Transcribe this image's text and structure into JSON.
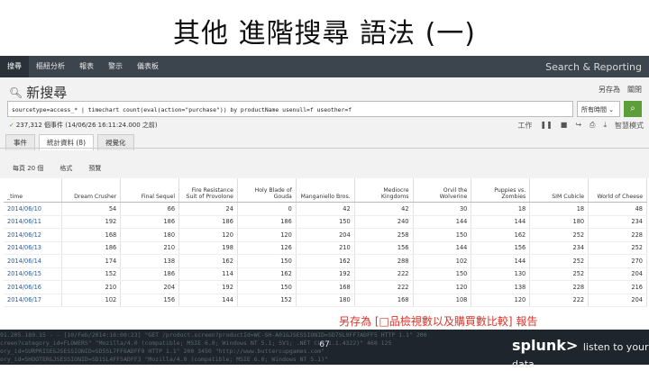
{
  "slide": {
    "title": "其他 進階搜尋 語法 (一)",
    "caption": "另存為 [□品檢視數以及購買數比較] 報告",
    "page_number": "67"
  },
  "nav": {
    "items": [
      "搜尋",
      "樞紐分析",
      "報表",
      "警示",
      "儀表板"
    ],
    "brand": "Search & Reporting"
  },
  "search": {
    "title": "新搜尋",
    "save_as": "另存為",
    "close": "關閉",
    "query": "sourcetype=access_* | timechart count(eval(action=\"purchase\")) by productName usenull=f useother=f",
    "time_range": "所有時間",
    "status": "237,312 個事件 (14/06/26 16:11:24.000 之前)",
    "job": "工作",
    "mode": "智慧模式"
  },
  "tabs": [
    "事件",
    "統計資料 (8)",
    "視覺化"
  ],
  "format_bar": [
    "每頁 20 個",
    "格式",
    "預覽"
  ],
  "table": {
    "columns": [
      "_time",
      "Dream Crusher",
      "Final Sequel",
      "Fire Resistance Suit of Provolone",
      "Holy Blade of Gouda",
      "Manganiello Bros.",
      "Mediocre Kingdoms",
      "Orvil the Wolverine",
      "Puppies vs. Zombies",
      "SIM Cubicle",
      "World of Cheese"
    ],
    "rows": [
      [
        "2014/06/10",
        "54",
        "66",
        "24",
        "0",
        "42",
        "42",
        "30",
        "18",
        "18",
        "48"
      ],
      [
        "2014/06/11",
        "192",
        "186",
        "186",
        "186",
        "150",
        "240",
        "144",
        "144",
        "180",
        "234"
      ],
      [
        "2014/06/12",
        "168",
        "180",
        "120",
        "120",
        "204",
        "258",
        "150",
        "162",
        "252",
        "228"
      ],
      [
        "2014/06/13",
        "186",
        "210",
        "198",
        "126",
        "210",
        "156",
        "144",
        "156",
        "234",
        "252"
      ],
      [
        "2014/06/14",
        "174",
        "138",
        "162",
        "150",
        "162",
        "288",
        "102",
        "144",
        "252",
        "270"
      ],
      [
        "2014/06/15",
        "152",
        "186",
        "114",
        "162",
        "192",
        "222",
        "150",
        "130",
        "252",
        "204"
      ],
      [
        "2014/06/16",
        "210",
        "204",
        "192",
        "150",
        "168",
        "222",
        "120",
        "138",
        "228",
        "216"
      ],
      [
        "2014/06/17",
        "102",
        "156",
        "144",
        "152",
        "180",
        "168",
        "108",
        "120",
        "222",
        "204"
      ]
    ]
  },
  "footer": {
    "logo": "splunk>",
    "tagline": "listen to your data",
    "log_lines": [
      "91.205.189.15 - - [10/Feb/2014:16:00:23] \"GET /product.screen?productId=WC-SH-A01&JSESSIONID=SD7SL9FF7ADFF5 HTTP 1.1\" 200",
      "creen?category_id=FLOWERS\" \"Mozilla/4.0 (compatible; MSIE 6.0; Windows NT 5.1; SV1; .NET CLR 1.1.4322)\" 468 125",
      "ory_id=SURPRISE&JSESSIONID=SD5SL7FF6ADFF9 HTTP 1.1\" 200 3450 \"http://www.buttercupgames.com\"",
      "ory_id=SHOOTER&JSESSIONID=SD1SL4FF5ADFF3 \"Mozilla/4.0 (compatible; MSIE 6.0; Windows NT 5.1)\""
    ]
  }
}
